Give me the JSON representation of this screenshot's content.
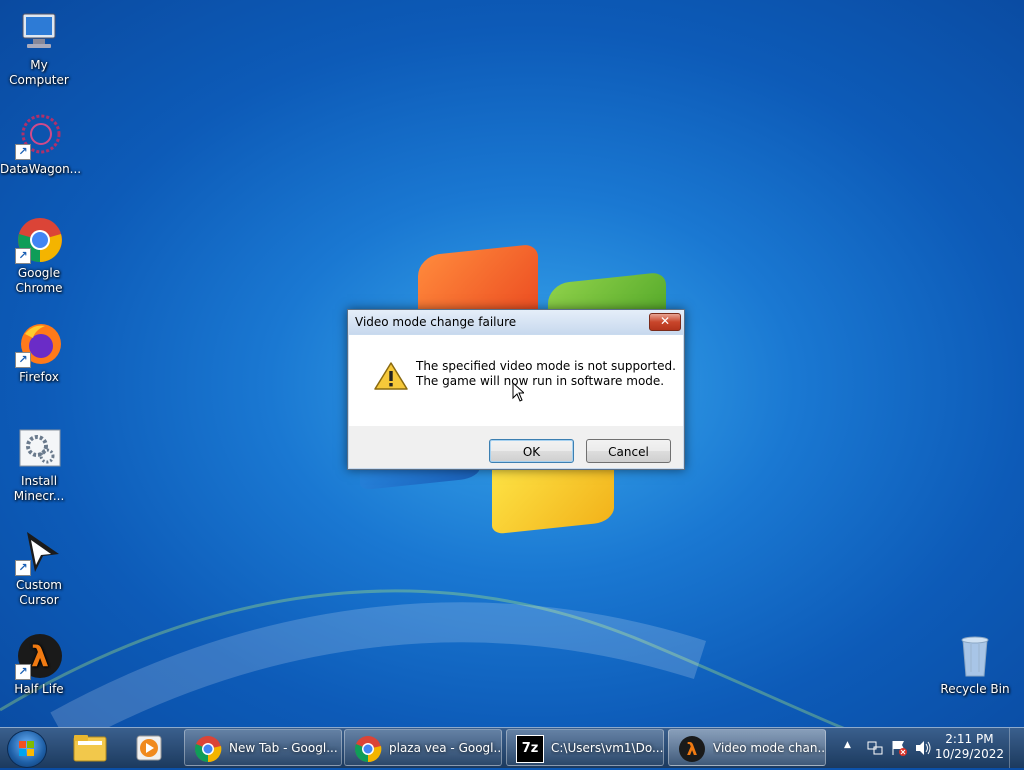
{
  "desktop_icons": [
    {
      "label": "My Computer",
      "icon": "computer-icon"
    },
    {
      "label": "DataWagon...",
      "icon": "datawagon-icon"
    },
    {
      "label": "Google Chrome",
      "icon": "chrome-icon"
    },
    {
      "label": "Firefox",
      "icon": "firefox-icon"
    },
    {
      "label": "Install Minecr...",
      "icon": "installer-icon"
    },
    {
      "label": "Custom Cursor",
      "icon": "cursor-icon"
    },
    {
      "label": "Half Life",
      "icon": "halflife-icon"
    },
    {
      "label": "Recycle Bin",
      "icon": "recycle-bin-icon"
    }
  ],
  "dialog": {
    "title": "Video mode change failure",
    "close_label": "✕",
    "message_line1": "The specified video mode is not supported.",
    "message_line2": "The game will now run in software mode.",
    "ok_label": "OK",
    "cancel_label": "Cancel",
    "icon": "warning-icon"
  },
  "taskbar": {
    "pinned": [
      {
        "icon": "file-explorer-icon"
      },
      {
        "icon": "media-player-icon"
      }
    ],
    "windows": [
      {
        "label": "New Tab - Googl...",
        "icon": "chrome-icon"
      },
      {
        "label": "plaza vea - Googl...",
        "icon": "chrome-icon"
      },
      {
        "label": "C:\\Users\\vm1\\Do...",
        "icon": "7zip-icon",
        "icon_text": "7z"
      },
      {
        "label": "Video mode chan...",
        "icon": "halflife-icon"
      }
    ],
    "clock_time": "2:11 PM",
    "clock_date": "10/29/2022",
    "tray_arrow": "▲"
  },
  "colors": {
    "wallpaper": "#1a78d2",
    "taskbar": "#1c3a5e",
    "dialog_frame": "#c9dbef",
    "close_button": "#c8452b"
  }
}
